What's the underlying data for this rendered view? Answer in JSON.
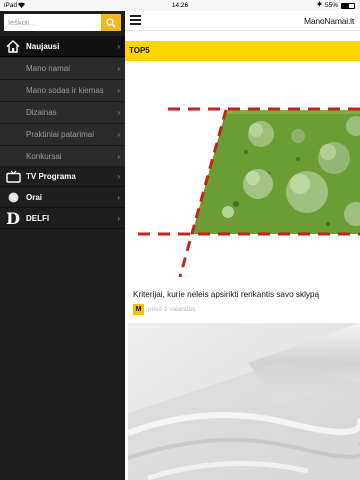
{
  "statusbar": {
    "carrier": "iPad",
    "time": "14:26",
    "battery_percent": "55%",
    "battery_level": 0.55
  },
  "search": {
    "placeholder": "Ieškoti..."
  },
  "sidebar": {
    "items": [
      {
        "label": "Naujausi",
        "kind": "top"
      },
      {
        "label": "Mano namai",
        "kind": "sub"
      },
      {
        "label": "Mano sodas ir kiemas",
        "kind": "sub"
      },
      {
        "label": "Dizainas",
        "kind": "sub"
      },
      {
        "label": "Praktiniai patarimai",
        "kind": "sub"
      },
      {
        "label": "Konkursai",
        "kind": "sub"
      },
      {
        "label": "TV Programa",
        "kind": "main"
      },
      {
        "label": "Orai",
        "kind": "main"
      },
      {
        "label": "DELFI",
        "kind": "main"
      }
    ]
  },
  "header": {
    "logo": "ManoNamai.lt"
  },
  "section": {
    "title": "TOP5"
  },
  "articles": [
    {
      "title": "Kriterijai, kurie neleis apsirikti renkantis savo sklypą",
      "badge": "M",
      "time": "prieš 2 valandas"
    }
  ],
  "colors": {
    "accent": "#ffd500",
    "search_button": "#f3b81c",
    "sidebar_bg": "#1e1e1e"
  }
}
